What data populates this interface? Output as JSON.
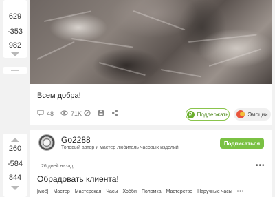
{
  "votes": [
    {
      "up_count": "629",
      "down_count": "-353",
      "total": "982"
    },
    {
      "up_count": "260",
      "down_count": "-584",
      "total": "844"
    }
  ],
  "post1": {
    "image_alt": "cat fur photo",
    "text": "Всем добра!",
    "comments": "48",
    "views": "71K",
    "support_label": "Поддержать",
    "emotions_label": "Эмоции"
  },
  "post2": {
    "author": {
      "name": "Go2288",
      "description": "Топовый автор и мастер любитель часовых изделий."
    },
    "subscribe_label": "Подписаться",
    "time_ago": "26 дней назад",
    "title": "Обрадовать клиента!",
    "tags": [
      "[моё]",
      "Мастер",
      "Мастерская",
      "Часы",
      "Хобби",
      "Поломка",
      "Мастерство",
      "Наручные часы"
    ]
  },
  "colors": {
    "accent_green": "#7ac143",
    "support_green": "#4f8a1e",
    "background": "#f2f2f2"
  },
  "icons": [
    "comment-icon",
    "eye-icon",
    "hide-icon",
    "save-icon",
    "share-icon",
    "support-icon",
    "emotion-icon",
    "more-dots-icon",
    "arrow-up-icon",
    "arrow-down-icon"
  ]
}
